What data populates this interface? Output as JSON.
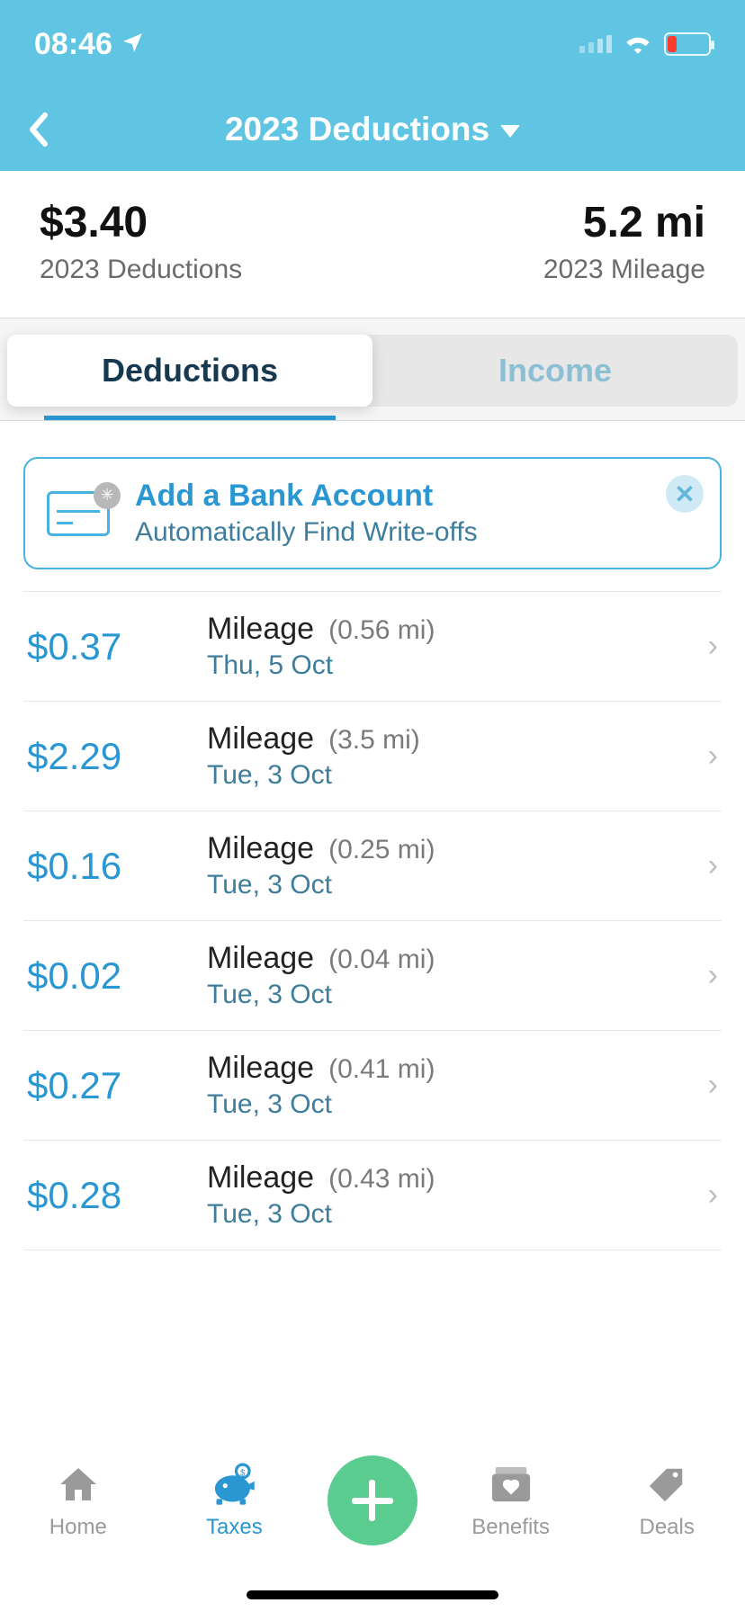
{
  "status": {
    "time": "08:46"
  },
  "header": {
    "title": "2023 Deductions"
  },
  "summary": {
    "amount": "$3.40",
    "amount_label": "2023 Deductions",
    "miles": "5.2 mi",
    "miles_label": "2023 Mileage"
  },
  "tabs": {
    "deductions": "Deductions",
    "income": "Income"
  },
  "banner": {
    "title": "Add a Bank Account",
    "subtitle": "Automatically Find Write-offs"
  },
  "entries": [
    {
      "amount": "$0.37",
      "category": "Mileage",
      "distance": "(0.56 mi)",
      "date": "Thu, 5 Oct"
    },
    {
      "amount": "$2.29",
      "category": "Mileage",
      "distance": "(3.5 mi)",
      "date": "Tue, 3 Oct"
    },
    {
      "amount": "$0.16",
      "category": "Mileage",
      "distance": "(0.25 mi)",
      "date": "Tue, 3 Oct"
    },
    {
      "amount": "$0.02",
      "category": "Mileage",
      "distance": "(0.04 mi)",
      "date": "Tue, 3 Oct"
    },
    {
      "amount": "$0.27",
      "category": "Mileage",
      "distance": "(0.41 mi)",
      "date": "Tue, 3 Oct"
    },
    {
      "amount": "$0.28",
      "category": "Mileage",
      "distance": "(0.43 mi)",
      "date": "Tue, 3 Oct"
    }
  ],
  "tabbar": {
    "home": "Home",
    "taxes": "Taxes",
    "benefits": "Benefits",
    "deals": "Deals"
  }
}
